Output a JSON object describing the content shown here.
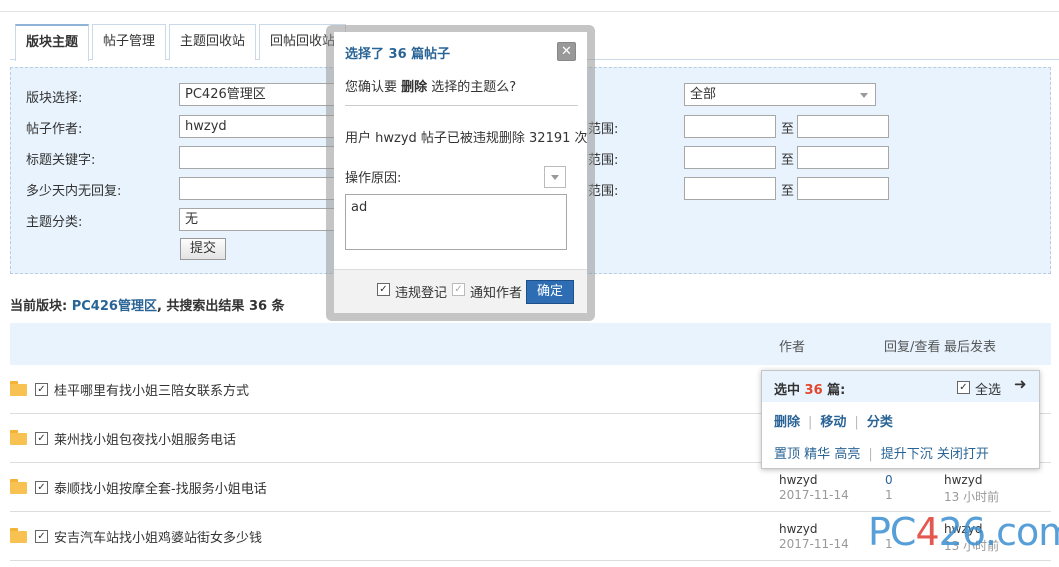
{
  "tabs": [
    "版块主题",
    "帖子管理",
    "主题回收站",
    "回帖回收站"
  ],
  "search": {
    "forum_label": "版块选择:",
    "forum_value": "PC426管理区",
    "author_label": "帖子作者:",
    "author_value": "hwzyd",
    "keyword_label": "标题关键字:",
    "days_label": "多少天内无回复:",
    "category_label": "主题分类:",
    "category_value": "无",
    "right_select_value": "全部",
    "range_suffix": "范围:",
    "to_label": "至",
    "submit_label": "提交"
  },
  "result": {
    "prefix": "当前版块: ",
    "forum": "PC426管理区",
    "suffix": ", 共搜索出结果 36 条"
  },
  "list": {
    "header": {
      "author": "作者",
      "reply_view": "回复/查看",
      "last_post": "最后发表"
    },
    "rows": [
      {
        "title": "桂平哪里有找小姐三陪女联系方式"
      },
      {
        "title": "莱州找小姐包夜找小姐服务电话"
      },
      {
        "title": "泰顺找小姐按摩全套-找服务小姐电话",
        "author": "hwzyd",
        "date": "2017-11-14",
        "replies": "0",
        "views": "1",
        "last_user": "hwzyd",
        "last_time": "13 小时前"
      },
      {
        "title": "安吉汽车站找小姐鸡婆站街女多少钱",
        "author": "hwzyd",
        "date": "2017-11-14",
        "replies": "",
        "views": "1",
        "last_user": "hwzyd",
        "last_time": "13 小时前"
      }
    ]
  },
  "modpanel": {
    "title_prefix": "选中 ",
    "count": "36",
    "title_suffix": " 篇:",
    "select_all": "全选",
    "delete": "删除",
    "move": "移动",
    "classify": "分类",
    "sticky": "置顶",
    "digest": "精华",
    "highlight": "高亮",
    "bump": "提升下沉",
    "close_open": "关闭打开"
  },
  "dialog": {
    "title": "选择了 36 篇帖子",
    "confirm_prefix": "您确认要 ",
    "confirm_action": "删除",
    "confirm_suffix": " 选择的主题么?",
    "info": "用户 hwzyd 帖子已被违规删除 32191 次",
    "reason_label": "操作原因:",
    "reason_value": "ad",
    "violation_label": "违规登记",
    "notify_label": "通知作者",
    "ok_label": "确定"
  },
  "watermark": {
    "pre": "PC",
    "mid": "4",
    "post": "26.com"
  },
  "colors": {
    "accent": "#2a6496",
    "button": "#2e6db4",
    "count": "#e3462b",
    "panel_bg": "#e8f3fd"
  }
}
